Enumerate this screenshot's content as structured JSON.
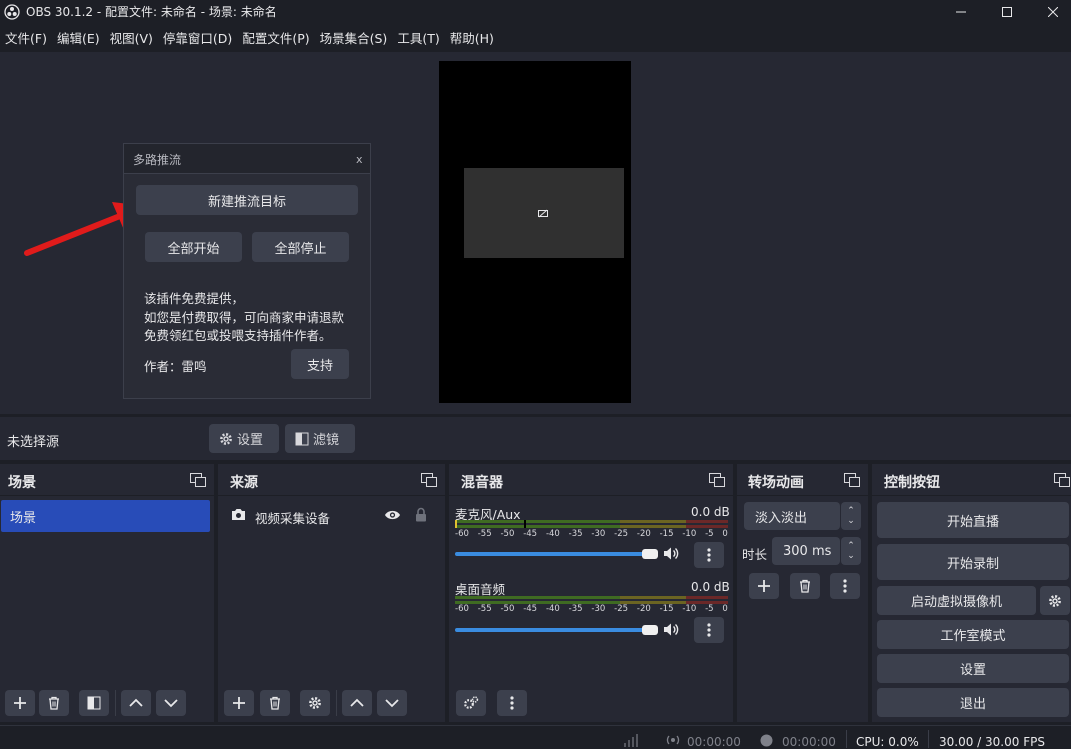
{
  "window": {
    "title": "OBS 30.1.2 - 配置文件: 未命名 - 场景: 未命名",
    "minimize_icon": "minimize-icon",
    "maximize_icon": "maximize-icon",
    "close_icon": "close-icon"
  },
  "menu": [
    "文件(F)",
    "编辑(E)",
    "视图(V)",
    "停靠窗口(D)",
    "配置文件(P)",
    "场景集合(S)",
    "工具(T)",
    "帮助(H)"
  ],
  "dialog": {
    "title": "多路推流",
    "close": "x",
    "new_target": "新建推流目标",
    "start_all": "全部开始",
    "stop_all": "全部停止",
    "info_lines": [
      "该插件免费提供，",
      "如您是付费取得，可向商家申请退款",
      "免费领红包或投喂支持插件作者。"
    ],
    "author": "作者：雷鸣",
    "support": "支持"
  },
  "source_toolbar": {
    "no_source": "未选择源",
    "settings": "设置",
    "filters": "滤镜"
  },
  "docks": {
    "scenes": {
      "title": "场景",
      "items": [
        "场景"
      ]
    },
    "sources": {
      "title": "来源",
      "items": [
        "视频采集设备"
      ]
    },
    "mixer": {
      "title": "混音器",
      "channels": [
        {
          "name": "麦克风/Aux",
          "db": "0.0 dB",
          "volume": 1.0
        },
        {
          "name": "桌面音频",
          "db": "0.0 dB",
          "volume": 1.0
        }
      ],
      "ticks": [
        "-60",
        "-55",
        "-50",
        "-45",
        "-40",
        "-35",
        "-30",
        "-25",
        "-20",
        "-15",
        "-10",
        "-5",
        "0"
      ]
    },
    "transitions": {
      "title": "转场动画",
      "selected": "淡入淡出",
      "duration_label": "时长",
      "duration": "300 ms"
    },
    "controls": {
      "title": "控制按钮",
      "start_stream": "开始直播",
      "start_record": "开始录制",
      "virtual_cam": "启动虚拟摄像机",
      "studio_mode": "工作室模式",
      "settings": "设置",
      "exit": "退出"
    }
  },
  "status": {
    "stream_time": "00:00:00",
    "record_time": "00:00:00",
    "cpu": "CPU: 0.0%",
    "fps": "30.00 / 30.00 FPS"
  },
  "colors": {
    "accent": "#284cb8",
    "slider": "#3a8ce0",
    "arrow": "#e01b1b"
  }
}
